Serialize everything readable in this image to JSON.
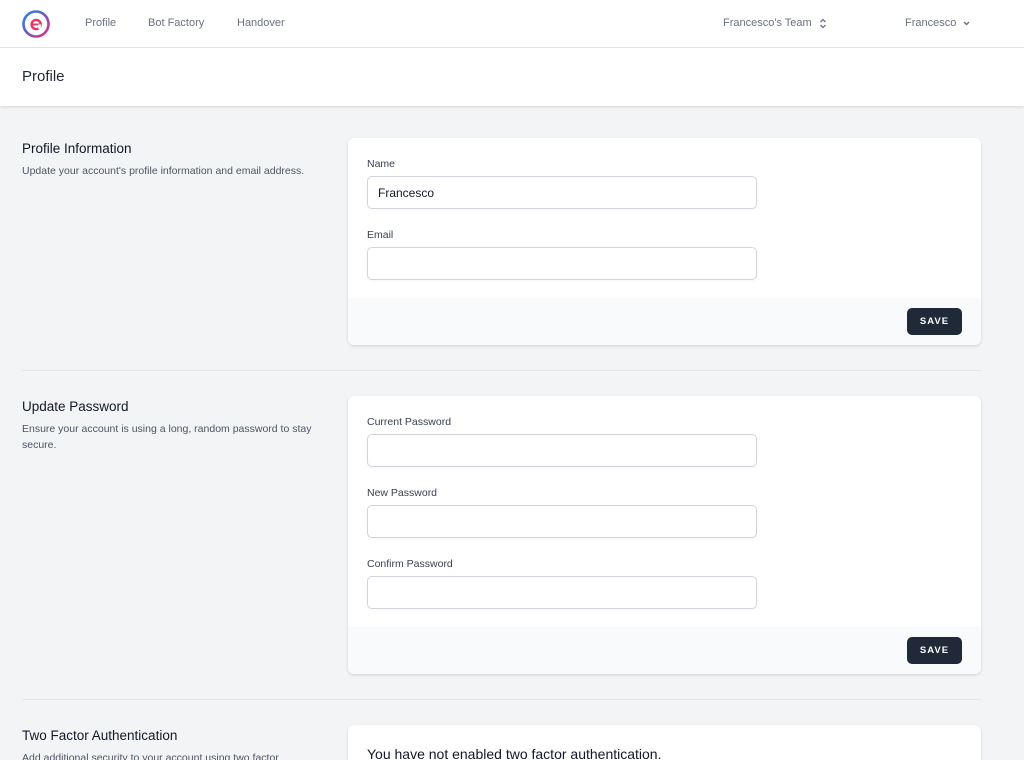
{
  "nav": {
    "links": [
      "Profile",
      "Bot Factory",
      "Handover"
    ],
    "team": "Francesco's Team",
    "user": "Francesco"
  },
  "header": {
    "title": "Profile"
  },
  "profile_info": {
    "title": "Profile Information",
    "description": "Update your account's profile information and email address.",
    "name_label": "Name",
    "name_value": "Francesco",
    "email_label": "Email",
    "email_value": "",
    "save_label": "SAVE"
  },
  "update_password": {
    "title": "Update Password",
    "description": "Ensure your account is using a long, random password to stay secure.",
    "current_label": "Current Password",
    "new_label": "New Password",
    "confirm_label": "Confirm Password",
    "save_label": "SAVE"
  },
  "two_factor": {
    "title": "Two Factor Authentication",
    "description": "Add additional security to your account using two factor authentication.",
    "status": "You have not enabled two factor authentication."
  },
  "colors": {
    "background": "#f3f4f6",
    "card": "#ffffff",
    "button": "#1f2937",
    "logo_blue": "#1d8fd8",
    "logo_pink": "#e8366b"
  }
}
